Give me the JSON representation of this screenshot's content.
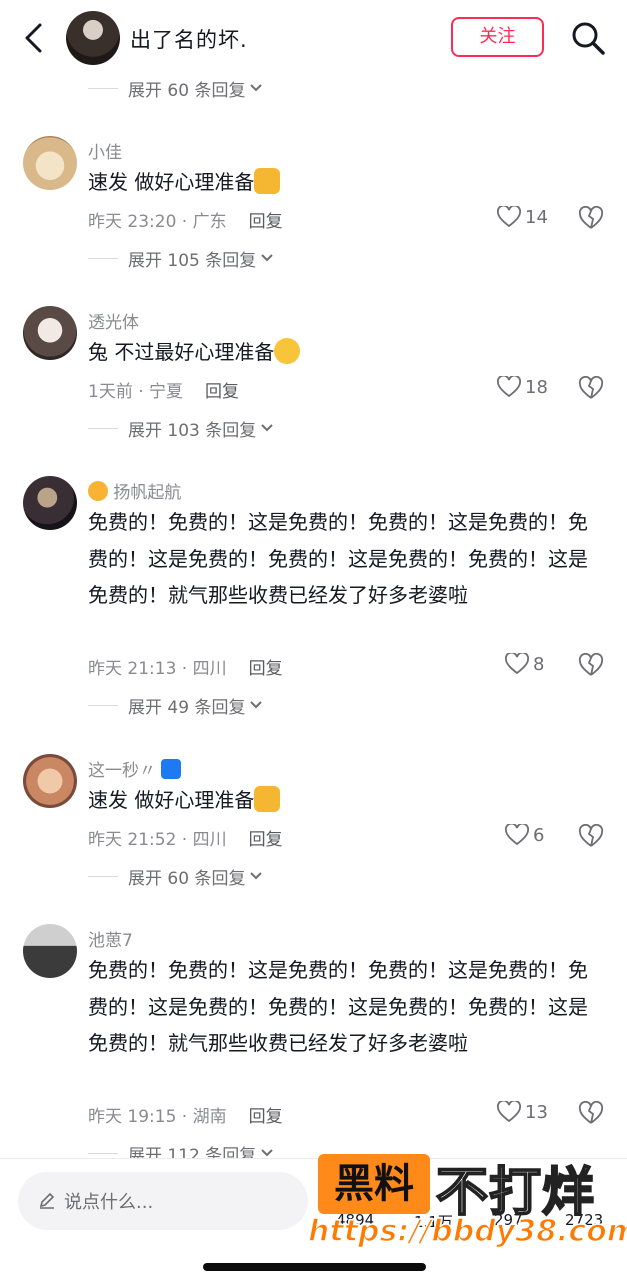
{
  "header": {
    "title": "出了名的坏.",
    "follow_label": "关注"
  },
  "top_expand": "展开 60 条回复",
  "comments": [
    {
      "user": "小佳",
      "text": "速发 做好心理准备",
      "time": "昨天 23:20 · 广东",
      "reply": "回复",
      "likes": "14",
      "expand": "展开 105 条回复"
    },
    {
      "user": "透光体",
      "text": "兔 不过最好心理准备",
      "time": "1天前 · 宁夏",
      "reply": "回复",
      "likes": "18",
      "expand": "展开 103 条回复"
    },
    {
      "user": "扬帆起航",
      "text": "免费的！免费的！这是免费的！免费的！这是免费的！免费的！这是免费的！免费的！这是免费的！免费的！这是免费的！就气那些收费已经发了好多老婆啦",
      "time": "昨天 21:13 · 四川",
      "reply": "回复",
      "likes": "8",
      "expand": "展开 49 条回复"
    },
    {
      "user": "这一秒〃",
      "text": "速发 做好心理准备",
      "time": "昨天 21:52 · 四川",
      "reply": "回复",
      "likes": "6",
      "expand": "展开 60 条回复"
    },
    {
      "user": "池葸7",
      "text": "免费的！免费的！这是免费的！免费的！这是免费的！免费的！这是免费的！免费的！这是免费的！免费的！这是免费的！就气那些收费已经发了好多老婆啦",
      "time": "昨天 19:15 · 湖南",
      "reply": "回复",
      "likes": "13",
      "expand": "展开 112 条回复"
    }
  ],
  "bottom": {
    "placeholder": "说点什么...",
    "stats": [
      "4894",
      "1.1万",
      "297",
      "2723"
    ]
  },
  "watermark": {
    "box": "黑料",
    "text": "不打烊",
    "url": "https://bbdy38.com"
  },
  "colors": {
    "accent": "#fe2c55",
    "meta": "#8a8b91",
    "text": "#161823"
  }
}
